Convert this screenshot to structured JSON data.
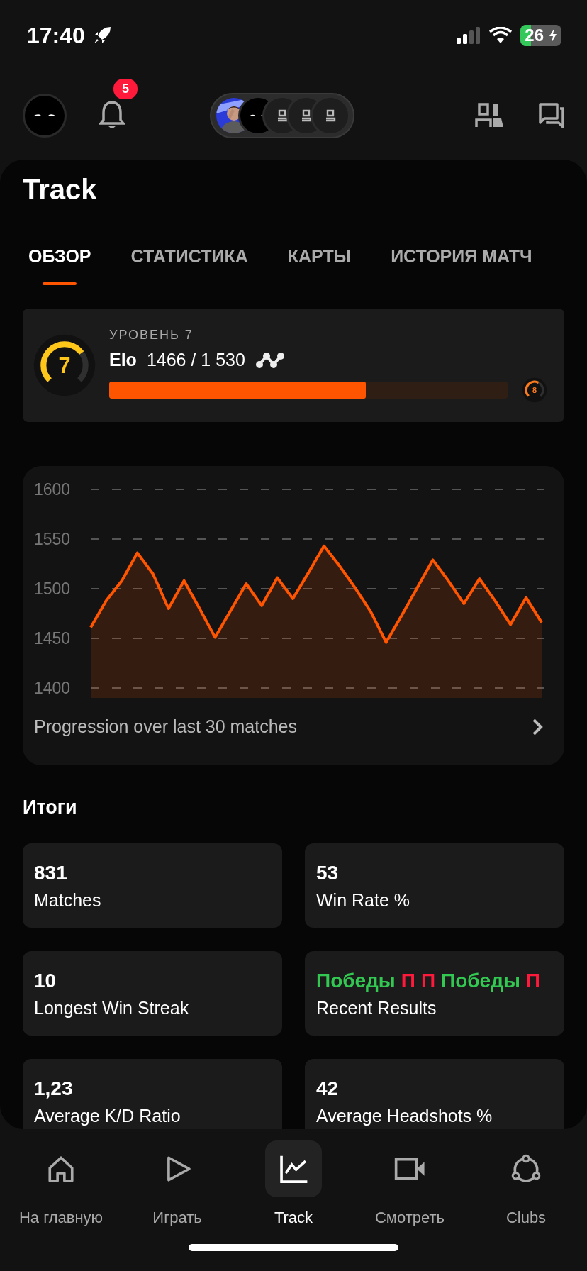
{
  "status_bar": {
    "time": "17:40",
    "battery": "26"
  },
  "header": {
    "notifications": "5",
    "party": [
      {
        "kind": "picture"
      },
      {
        "kind": "masked"
      },
      {
        "kind": "empty"
      },
      {
        "kind": "empty"
      },
      {
        "kind": "empty"
      }
    ]
  },
  "title": "Track",
  "tabs": [
    {
      "label": "ОБЗОР",
      "selected": true
    },
    {
      "label": "СТАТИСТИКА",
      "selected": false
    },
    {
      "label": "КАРТЫ",
      "selected": false
    },
    {
      "label": "ИСТОРИЯ МАТЧ",
      "selected": false
    }
  ],
  "level_card": {
    "label": "УРОВЕНЬ 7",
    "gauge": {
      "value": "7",
      "level": 0.7
    },
    "elo_label": "Elo",
    "elo_value": "1466 / 1 530",
    "progress": {
      "level": 0.645
    },
    "next_gauge": {
      "value": "8",
      "level": 0.6
    }
  },
  "elo_chart": {
    "chart_data": {
      "type": "area",
      "grid": true,
      "ylim": [
        1400,
        1600
      ],
      "yticks": [
        1400,
        1450,
        1500,
        1550,
        1600
      ],
      "series": [
        {
          "color": "#ff5500",
          "values": [
            1461,
            1488,
            1508,
            1536,
            1515,
            1480,
            1508,
            1480,
            1451,
            1478,
            1505,
            1483,
            1511,
            1490,
            1516,
            1543,
            1523,
            1501,
            1477,
            1446,
            1473,
            1501,
            1529,
            1508,
            1485,
            1510,
            1488,
            1464,
            1491,
            1466
          ]
        }
      ]
    },
    "caption": "Progression over last 30 matches"
  },
  "summary": {
    "title": "Итоги",
    "stats": [
      {
        "kind": "number",
        "value": "831",
        "label": "Matches"
      },
      {
        "kind": "number",
        "value": "53",
        "label": "Win Rate %"
      },
      {
        "kind": "number",
        "value": "10",
        "label": "Longest Win Streak"
      },
      {
        "kind": "results",
        "results": [
          {
            "text": "Победы",
            "color": "#32c851"
          },
          {
            "text": "П",
            "color": "#ff1a3c"
          },
          {
            "text": "П",
            "color": "#ff1a3c"
          },
          {
            "text": "Победы",
            "color": "#32c851"
          },
          {
            "text": "П",
            "color": "#ff1a3c"
          }
        ],
        "label": "Recent Results"
      },
      {
        "kind": "number",
        "value": "1,23",
        "label": "Average K/D Ratio"
      },
      {
        "kind": "number",
        "value": "42",
        "label": "Average Headshots %"
      }
    ]
  },
  "nav": [
    {
      "kind": "home",
      "label": "На главную",
      "selected": false
    },
    {
      "kind": "play",
      "label": "Играть",
      "selected": false
    },
    {
      "kind": "track",
      "label": "Track",
      "selected": true
    },
    {
      "kind": "watch",
      "label": "Смотреть",
      "selected": false
    },
    {
      "kind": "clubs",
      "label": "Clubs",
      "selected": false
    }
  ]
}
